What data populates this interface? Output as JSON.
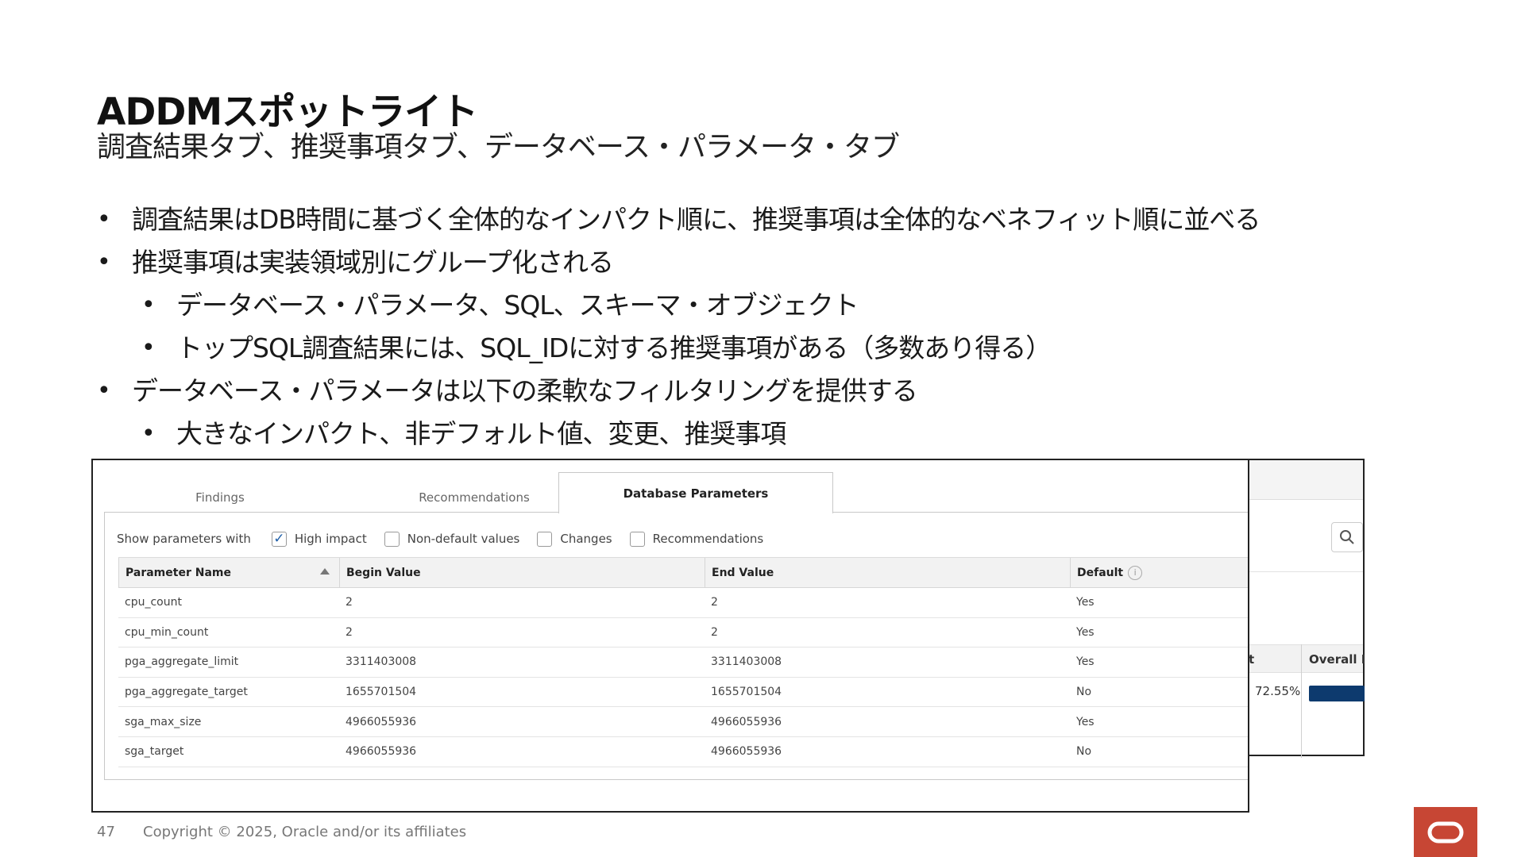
{
  "slide": {
    "title": "ADDMスポットライト",
    "subtitle": "調査結果タブ、推奨事項タブ、データベース・パラメータ・タブ",
    "bullets": [
      {
        "level": 1,
        "text": "調査結果はDB時間に基づく全体的なインパクト順に、推奨事項は全体的なベネフィット順に並べる"
      },
      {
        "level": 1,
        "text": "推奨事項は実装領域別にグループ化される"
      },
      {
        "level": 2,
        "text": "データベース・パラメータ、SQL、スキーマ・オブジェクト"
      },
      {
        "level": 2,
        "text": "トップSQL調査結果には、SQL_IDに対する推奨事項がある（多数あり得る）"
      },
      {
        "level": 1,
        "text": "データベース・パラメータは以下の柔軟なフィルタリングを提供する"
      },
      {
        "level": 2,
        "text": "大きなインパクト、非デフォルト値、変更、推奨事項"
      }
    ],
    "bullet_symbol": "•",
    "page_number": "47",
    "copyright": "Copyright © 2025, Oracle and/or its affiliates",
    "logo_color": "#c74634"
  },
  "background_shot": {
    "header_partial": "t",
    "header_overall": "Overall Be",
    "percent": "72.55%",
    "bar_color": "#0d3a6e",
    "search_icon": "search-icon"
  },
  "screenshot": {
    "tabs": [
      "Findings",
      "Recommendations",
      "Database Parameters"
    ],
    "active_tab": "Database Parameters",
    "filters": {
      "label": "Show parameters with",
      "options": [
        {
          "label": "High impact",
          "checked": true
        },
        {
          "label": "Non-default values",
          "checked": false
        },
        {
          "label": "Changes",
          "checked": false
        },
        {
          "label": "Recommendations",
          "checked": false
        }
      ]
    },
    "table": {
      "headers": [
        "Parameter Name",
        "Begin Value",
        "End Value",
        "Default"
      ],
      "rows": [
        [
          "cpu_count",
          "2",
          "2",
          "Yes"
        ],
        [
          "cpu_min_count",
          "2",
          "2",
          "Yes"
        ],
        [
          "pga_aggregate_limit",
          "3311403008",
          "3311403008",
          "Yes"
        ],
        [
          "pga_aggregate_target",
          "1655701504",
          "1655701504",
          "No"
        ],
        [
          "sga_max_size",
          "4966055936",
          "4966055936",
          "Yes"
        ],
        [
          "sga_target",
          "4966055936",
          "4966055936",
          "No"
        ]
      ]
    }
  }
}
